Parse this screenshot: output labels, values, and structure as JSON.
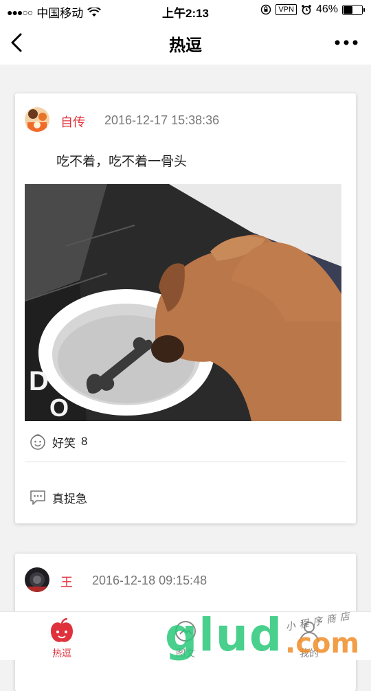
{
  "status_bar": {
    "carrier": "中国移动",
    "time": "上午2:13",
    "vpn": "VPN",
    "battery": "46%"
  },
  "nav": {
    "title": "热逗"
  },
  "posts": [
    {
      "author": "自传",
      "time": "2016-12-17 15:38:36",
      "text": "吃不着，吃不着一骨头",
      "funny_label": "好笑",
      "funny_count": "8",
      "comment_label": "真捉急"
    },
    {
      "author": "王",
      "time": "2016-12-18 09:15:48"
    }
  ],
  "tabbar": {
    "tabs": [
      {
        "label": "热逗",
        "icon": "apple-icon",
        "active": true
      },
      {
        "label": "图文",
        "icon": "image-icon",
        "active": false
      },
      {
        "label": "我的",
        "icon": "person-icon",
        "active": false
      }
    ]
  },
  "watermark": {
    "brand": "glud",
    "domain": ".com",
    "tagline": "小程序商店"
  },
  "colors": {
    "accent": "#e0323c",
    "background": "#f2f2f2"
  }
}
